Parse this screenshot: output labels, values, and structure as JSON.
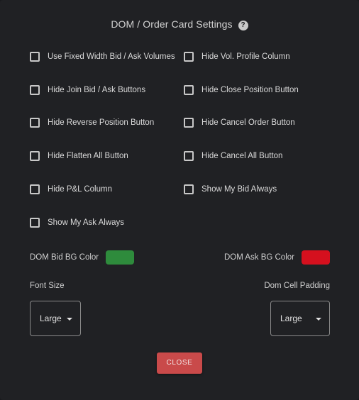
{
  "dialog": {
    "title": "DOM / Order Card Settings",
    "help_glyph": "?"
  },
  "options": [
    {
      "label": "Use Fixed Width Bid / Ask Volumes",
      "checked": false
    },
    {
      "label": "Hide Vol. Profile Column",
      "checked": false
    },
    {
      "label": "Hide Join Bid / Ask Buttons",
      "checked": false
    },
    {
      "label": "Hide Close Position Button",
      "checked": false
    },
    {
      "label": "Hide Reverse Position Button",
      "checked": false
    },
    {
      "label": "Hide Cancel Order Button",
      "checked": false
    },
    {
      "label": "Hide Flatten All Button",
      "checked": false
    },
    {
      "label": "Hide Cancel All Button",
      "checked": false
    },
    {
      "label": "Hide P&L Column",
      "checked": false
    },
    {
      "label": "Show My Bid Always",
      "checked": false
    },
    {
      "label": "Show My Ask Always",
      "checked": false
    }
  ],
  "colors": {
    "bid_label": "DOM Bid BG Color",
    "bid_color": "#2e8b3c",
    "ask_label": "DOM Ask BG Color",
    "ask_color": "#d5101e"
  },
  "font_size": {
    "label": "Font Size",
    "value": "Large"
  },
  "cell_padding": {
    "label": "Dom Cell Padding",
    "value": "Large"
  },
  "buttons": {
    "close_label": "CLOSE"
  }
}
